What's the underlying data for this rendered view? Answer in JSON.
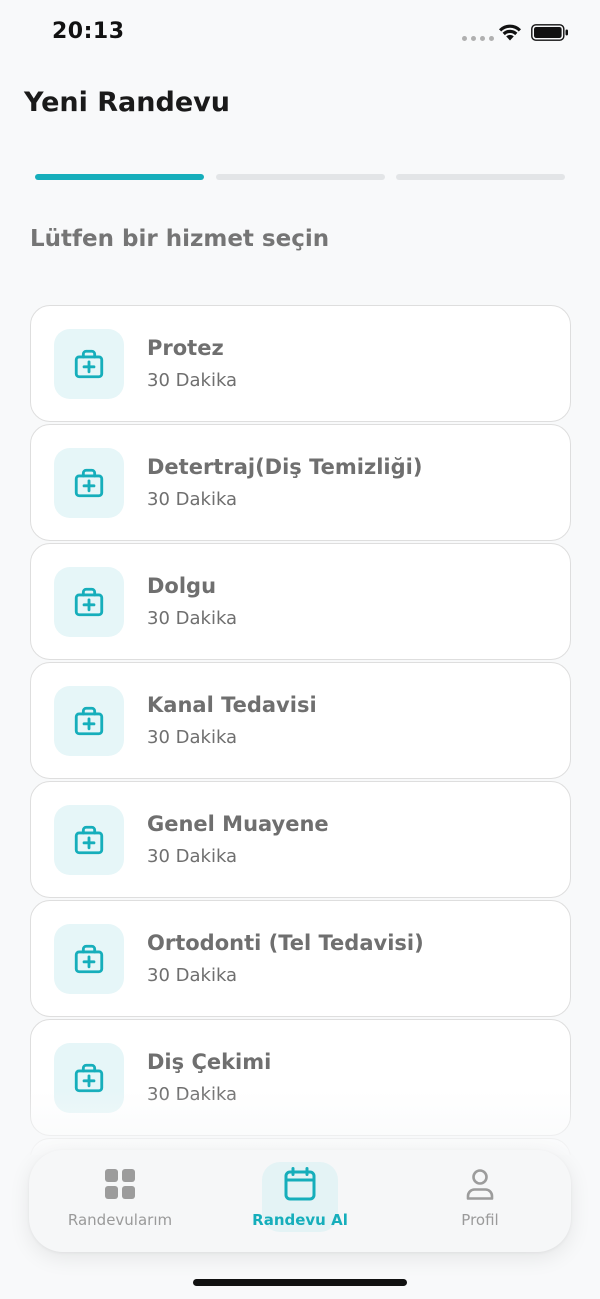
{
  "status_bar": {
    "time": "20:13"
  },
  "header": {
    "title": "Yeni Randevu"
  },
  "steps": {
    "total": 3,
    "current": 1
  },
  "subtitle": "Lütfen bir hizmet seçin",
  "services": [
    {
      "name": "Protez",
      "duration": "30 Dakika"
    },
    {
      "name": "Detertraj(Diş Temizliği)",
      "duration": "30 Dakika"
    },
    {
      "name": "Dolgu",
      "duration": "30 Dakika"
    },
    {
      "name": "Kanal Tedavisi",
      "duration": "30 Dakika"
    },
    {
      "name": "Genel Muayene",
      "duration": "30 Dakika"
    },
    {
      "name": "Ortodonti (Tel Tedavisi)",
      "duration": "30 Dakika"
    },
    {
      "name": "Diş Çekimi",
      "duration": "30 Dakika"
    }
  ],
  "service_icon": "medical-kit-icon",
  "bottom_nav": [
    {
      "label": "Randevularım",
      "icon": "grid-icon",
      "active": false
    },
    {
      "label": "Randevu Al",
      "icon": "calendar-icon",
      "active": true
    },
    {
      "label": "Profil",
      "icon": "person-icon",
      "active": false
    }
  ],
  "colors": {
    "accent": "#16aebb",
    "accent_light": "#e6f6f8",
    "text_muted": "#6f6f6f",
    "background": "#f8f9fa"
  }
}
